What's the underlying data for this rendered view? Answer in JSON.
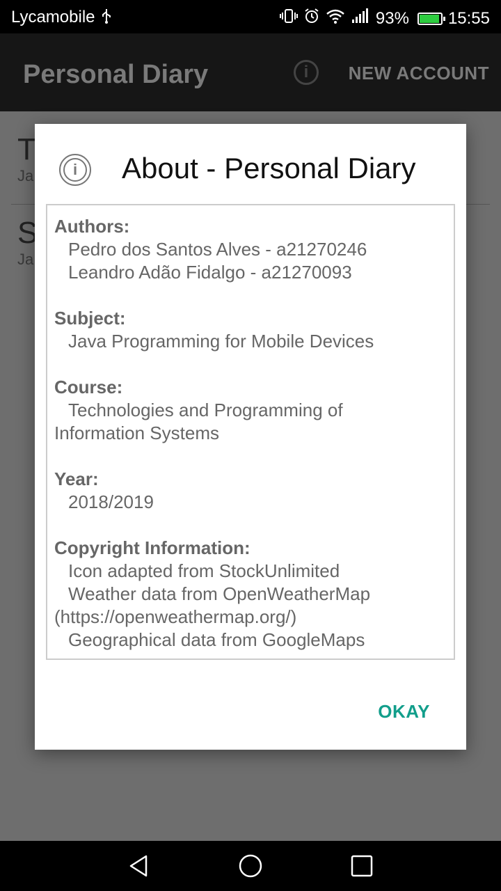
{
  "status_bar": {
    "carrier": "Lycamobile",
    "battery": "93%",
    "battery_level": 0.93,
    "time": "15:55"
  },
  "app_bar": {
    "title": "Personal Diary",
    "new_account": "NEW ACCOUNT"
  },
  "list_behind": {
    "items": [
      {
        "initial": "T",
        "date_fragment": "Ja"
      },
      {
        "initial": "S",
        "date_fragment": "Ja"
      }
    ]
  },
  "dialog": {
    "title": "About - Personal Diary",
    "authors_label": "Authors:",
    "authors": [
      "Pedro dos Santos Alves - a21270246",
      "Leandro Adão Fidalgo - a21270093"
    ],
    "subject_label": "Subject:",
    "subject": "Java Programming for Mobile Devices",
    "course_label": "Course:",
    "course_line1": "Technologies and Programming of",
    "course_line2": "Information Systems",
    "year_label": "Year:",
    "year": "2018/2019",
    "copyright_label": "Copyright Information:",
    "copyright_line1": "Icon adapted from StockUnlimited",
    "copyright_line2": "Weather data from OpenWeatherMap",
    "copyright_line3": "(https://openweathermap.org/)",
    "copyright_line4": "Geographical data from GoogleMaps",
    "okay_label": "OKAY"
  },
  "colors": {
    "accent": "#129e8b",
    "scrim": "#6e6e6e"
  }
}
